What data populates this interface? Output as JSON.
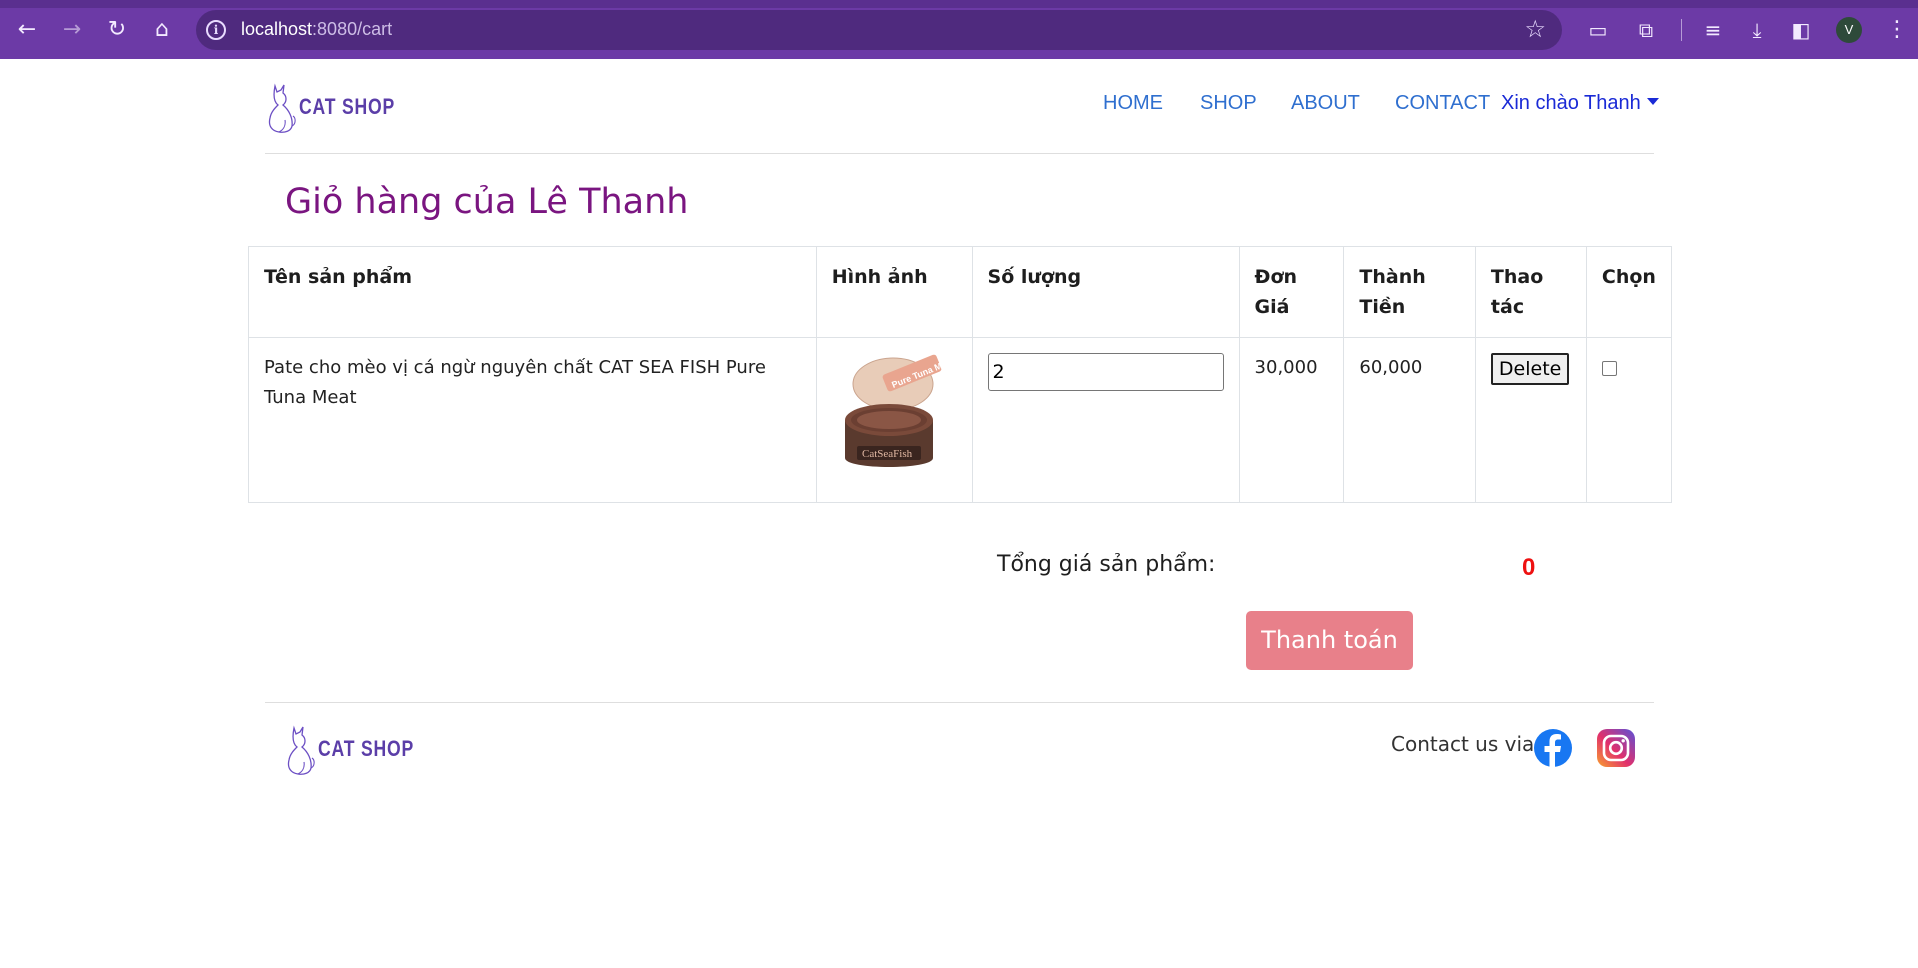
{
  "browser": {
    "url_host": "localhost",
    "url_path": ":8080/cart"
  },
  "header": {
    "logo_text": "CAT SHOP",
    "nav": [
      {
        "label": "HOME"
      },
      {
        "label": "SHOP"
      },
      {
        "label": "ABOUT"
      },
      {
        "label": "CONTACT"
      }
    ],
    "greeting": "Xin chào Thanh"
  },
  "page": {
    "title": "Giỏ hàng của Lê Thanh"
  },
  "cart_table": {
    "headers": [
      "Tên sản phẩm",
      "Hình ảnh",
      "Số lượng",
      "Đơn Giá",
      "Thành Tiền",
      "Thao tác",
      "Chọn"
    ],
    "rows": [
      {
        "name": "Pate cho mèo vị cá ngừ nguyên chất CAT SEA FISH Pure Tuna Meat",
        "image_label": "CatSeaFish",
        "image_tag": "Pure Tuna Meat",
        "quantity": "2",
        "unit_price": "30,000",
        "line_total": "60,000",
        "action_label": "Delete",
        "selected": false
      }
    ]
  },
  "summary": {
    "total_label": "Tổng giá sản phẩm:",
    "total_value": "0",
    "checkout_label": "Thanh toán"
  },
  "footer": {
    "logo_text": "CAT SHOP",
    "contact_text": "Contact us via"
  },
  "colors": {
    "chrome": "#6c3aa6",
    "title": "#7a1580",
    "nav_link": "#2f6fcf",
    "total": "#e11111",
    "checkout": "#e8808a"
  }
}
